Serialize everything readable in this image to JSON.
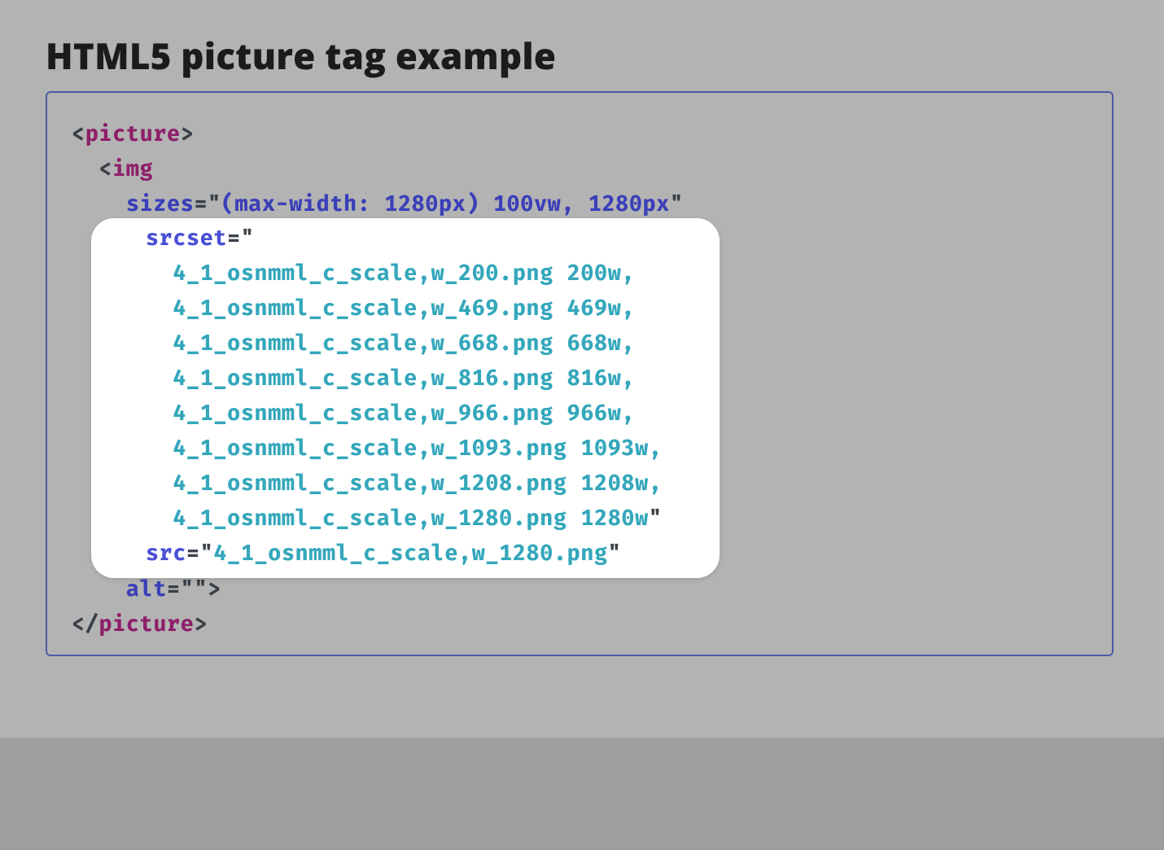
{
  "title": "HTML5 picture tag example",
  "code": {
    "tag_picture": "picture",
    "tag_img": "img",
    "attr_sizes": "sizes",
    "attr_srcset": "srcset",
    "attr_src": "src",
    "attr_alt": "alt",
    "val_sizes": "(max-width: 1280px) 100vw, 1280px",
    "val_alt": "",
    "val_src": "4_1_osnmml_c_scale,w_1280.png",
    "srcset_items": [
      "4_1_osnmml_c_scale,w_200.png 200w,",
      "4_1_osnmml_c_scale,w_469.png 469w,",
      "4_1_osnmml_c_scale,w_668.png 668w,",
      "4_1_osnmml_c_scale,w_816.png 816w,",
      "4_1_osnmml_c_scale,w_966.png 966w,",
      "4_1_osnmml_c_scale,w_1093.png 1093w,",
      "4_1_osnmml_c_scale,w_1208.png 1208w,",
      "4_1_osnmml_c_scale,w_1280.png 1280w"
    ]
  },
  "glyph": {
    "lt": "<",
    "gt": ">",
    "lt_slash": "</",
    "eq": "=",
    "q": "\""
  }
}
